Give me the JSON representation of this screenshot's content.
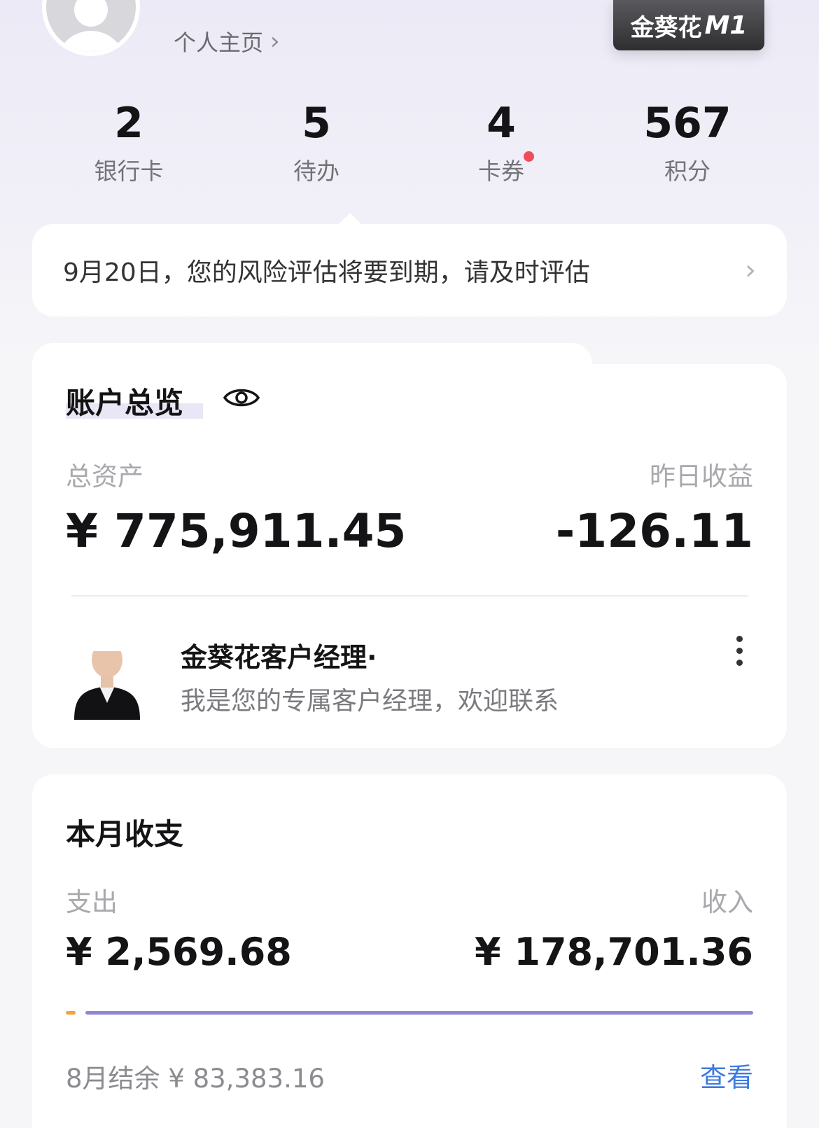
{
  "header": {
    "homepage_label": "个人主页",
    "level_badge": {
      "brand": "金葵花",
      "tier": "M1"
    }
  },
  "stats": [
    {
      "value": "2",
      "label": "银行卡"
    },
    {
      "value": "5",
      "label": "待办"
    },
    {
      "value": "4",
      "label": "卡券",
      "has_dot": true
    },
    {
      "value": "567",
      "label": "积分"
    }
  ],
  "notice": {
    "text": "9月20日，您的风险评估将要到期，请及时评估"
  },
  "account": {
    "title": "账户总览",
    "total_assets_label": "总资产",
    "total_assets_value": "¥ 775,911.45",
    "yesterday_label": "昨日收益",
    "yesterday_value": "-126.11",
    "manager": {
      "name": "金葵花客户经理·",
      "desc": "我是您的专属客户经理，欢迎联系"
    }
  },
  "monthly": {
    "title": "本月收支",
    "expense_label": "支出",
    "expense_value": "¥ 2,569.68",
    "income_label": "收入",
    "income_value": "¥ 178,701.36",
    "balance_text": "8月结余 ¥ 83,383.16",
    "view_label": "查看"
  },
  "colors": {
    "accent": "#8d86d2",
    "expense_bar": "#f2a33a",
    "link": "#3d7be0",
    "badge_dot": "#ef4d57"
  }
}
